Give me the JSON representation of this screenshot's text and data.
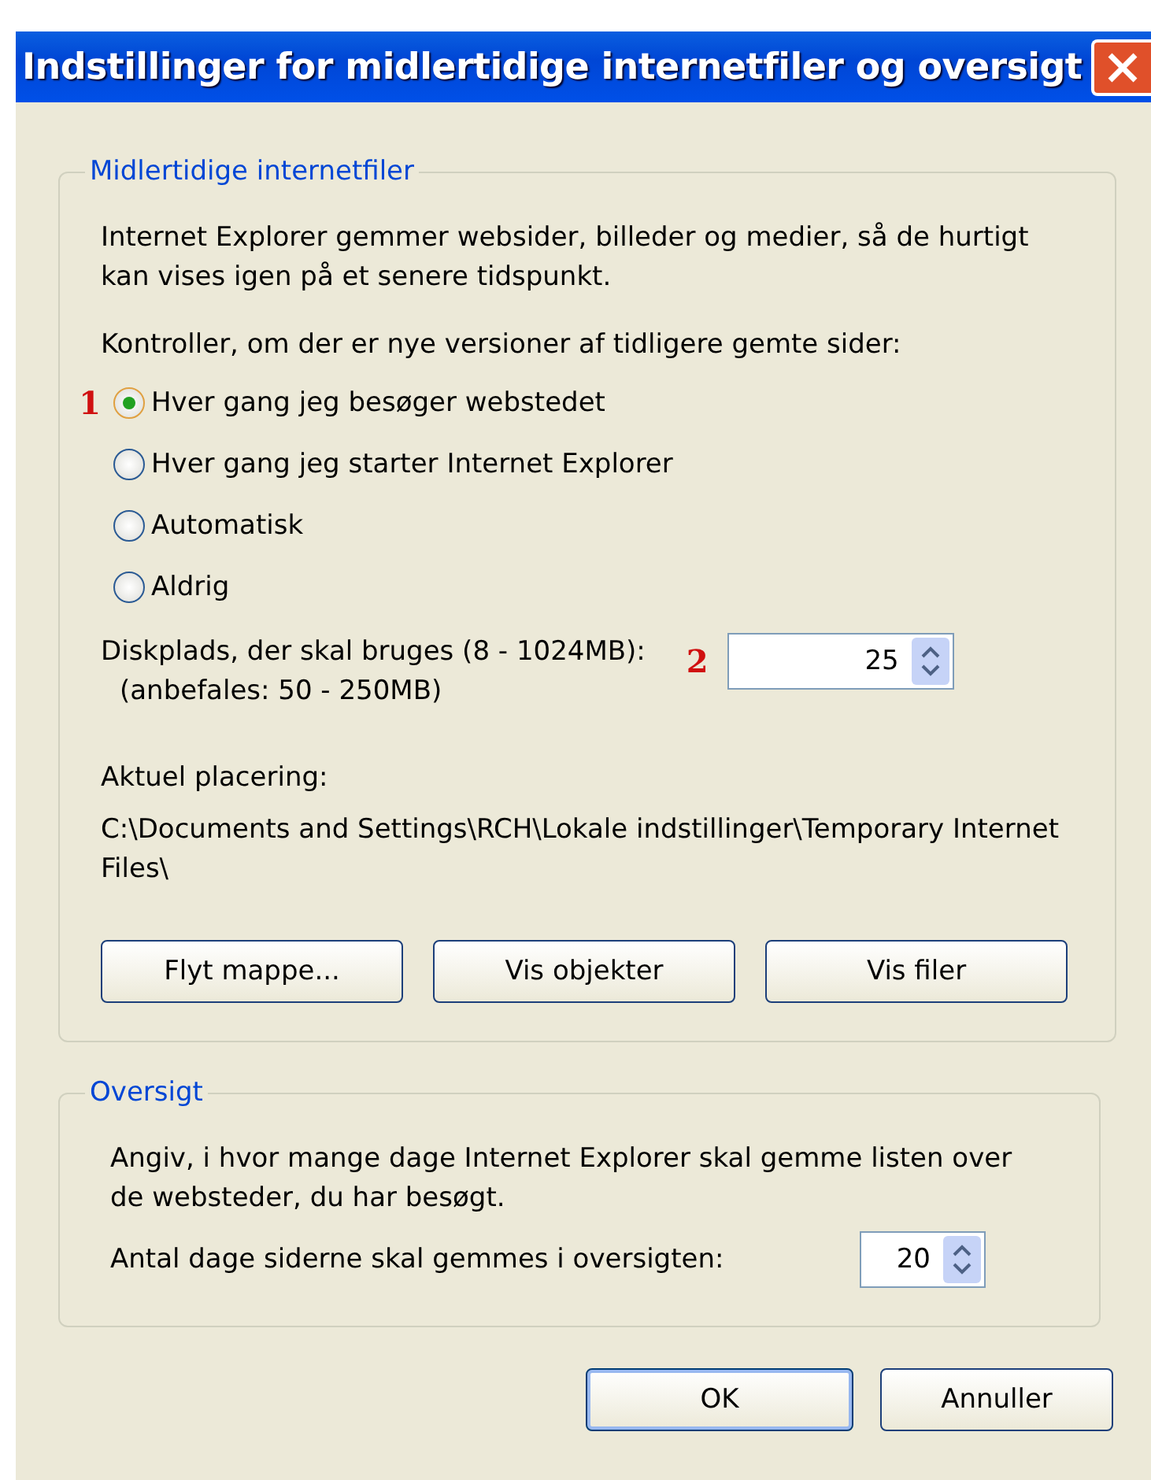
{
  "window": {
    "title": "Indstillinger for midlertidige internetfiler og oversigt"
  },
  "cache_group": {
    "legend": "Midlertidige internetfiler",
    "intro": "Internet Explorer gemmer websider, billeder og medier, så de hurtigt kan vises igen på et senere tidspunkt.",
    "check_label": "Kontroller, om der er nye versioner af tidligere gemte sider:",
    "radio_marker": "1",
    "options": [
      {
        "label": "Hver gang jeg besøger webstedet",
        "selected": true
      },
      {
        "label": "Hver gang jeg starter Internet Explorer",
        "selected": false
      },
      {
        "label": "Automatisk",
        "selected": false
      },
      {
        "label": "Aldrig",
        "selected": false
      }
    ],
    "disk_label": "Diskplads, der skal bruges (8 - 1024MB):",
    "disk_hint": "(anbefales: 50 - 250MB)",
    "disk_marker": "2",
    "disk_value": "25",
    "location_label": "Aktuel placering:",
    "location_path": "C:\\Documents and Settings\\RCH\\Lokale indstillinger\\Temporary Internet Files\\",
    "buttons": [
      "Flyt mappe...",
      "Vis objekter",
      "Vis filer"
    ]
  },
  "history_group": {
    "legend": "Oversigt",
    "intro": "Angiv, i hvor mange dage Internet Explorer skal gemme listen over de websteder, du har besøgt.",
    "days_label": "Antal dage siderne skal gemmes i oversigten:",
    "days_value": "20"
  },
  "buttons": [
    "OK",
    "Annuller"
  ]
}
